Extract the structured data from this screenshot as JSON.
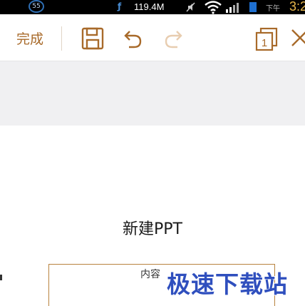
{
  "status_bar": {
    "badge": "55",
    "memory": "119.4M",
    "ampm": "下午",
    "time": "3:2",
    "icons": [
      "notification-badge-icon",
      "memory-icon",
      "mute-icon",
      "wifi-icon",
      "signal-icon",
      "battery-icon"
    ]
  },
  "toolbar": {
    "done_label": "完成",
    "page_count": "1",
    "icons": [
      "save-icon",
      "undo-icon",
      "redo-icon",
      "page-count-icon",
      "close-icon"
    ],
    "accent_color": "#a86a2a",
    "disabled_color": "#e8cdb0"
  },
  "slide": {
    "title": "新建PPT",
    "content_placeholder": "内容",
    "border_color": "#b8823e"
  },
  "watermark": {
    "text": "极速下载站",
    "color": "#2f4fbe"
  }
}
